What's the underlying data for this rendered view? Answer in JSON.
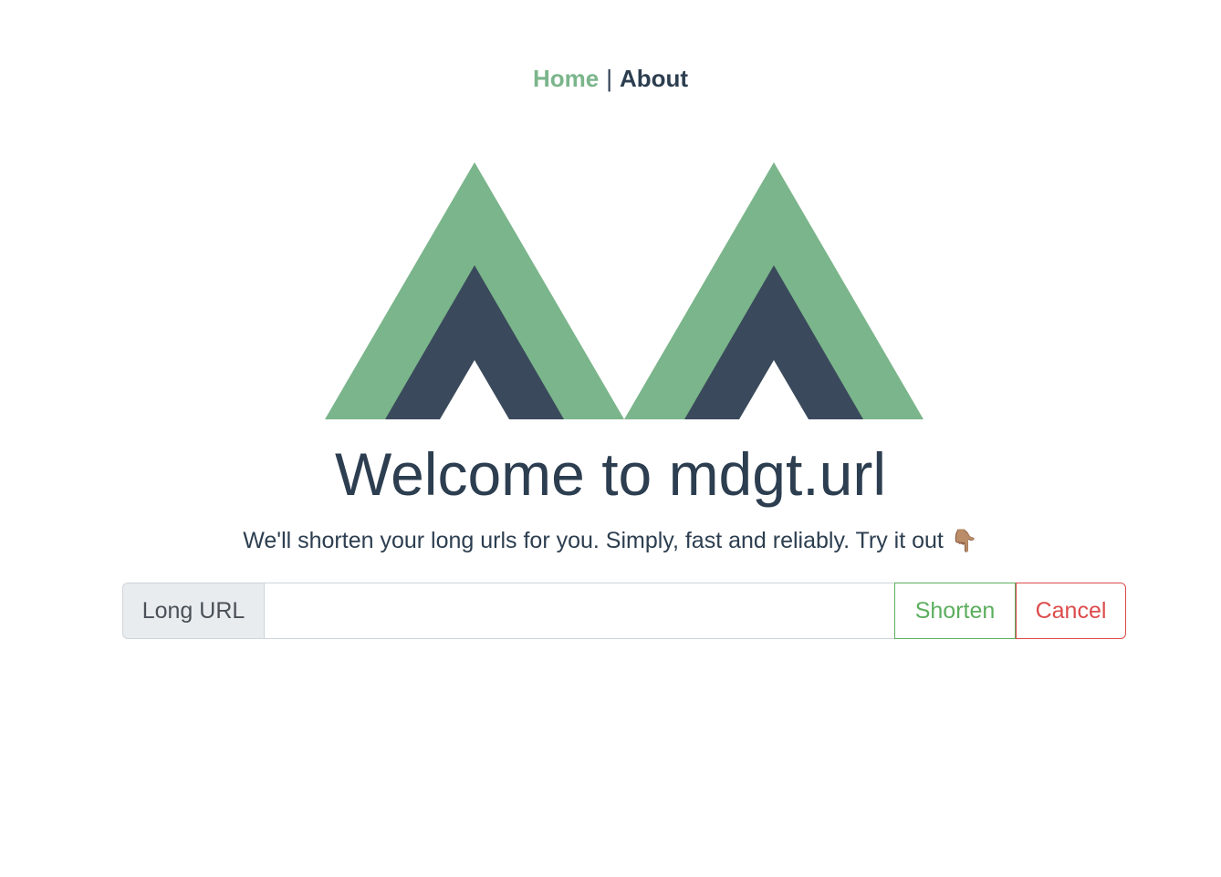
{
  "nav": {
    "home_label": "Home",
    "separator": "|",
    "about_label": "About"
  },
  "colors": {
    "logo_green": "#7bb58b",
    "logo_dark": "#3a4a5c",
    "success": "#5cae5f",
    "danger": "#dc4b4b",
    "text": "#2c3e50"
  },
  "hero": {
    "title": "Welcome to mdgt.url",
    "subtitle": "We'll shorten your long urls for you. Simply, fast and reliably. Try it out",
    "pointer_emoji": "👇🏽",
    "pointer_icon": "backhand-index-pointing-down-icon"
  },
  "form": {
    "prepend_label": "Long URL",
    "input_value": "",
    "input_placeholder": "",
    "shorten_label": "Shorten",
    "cancel_label": "Cancel"
  }
}
